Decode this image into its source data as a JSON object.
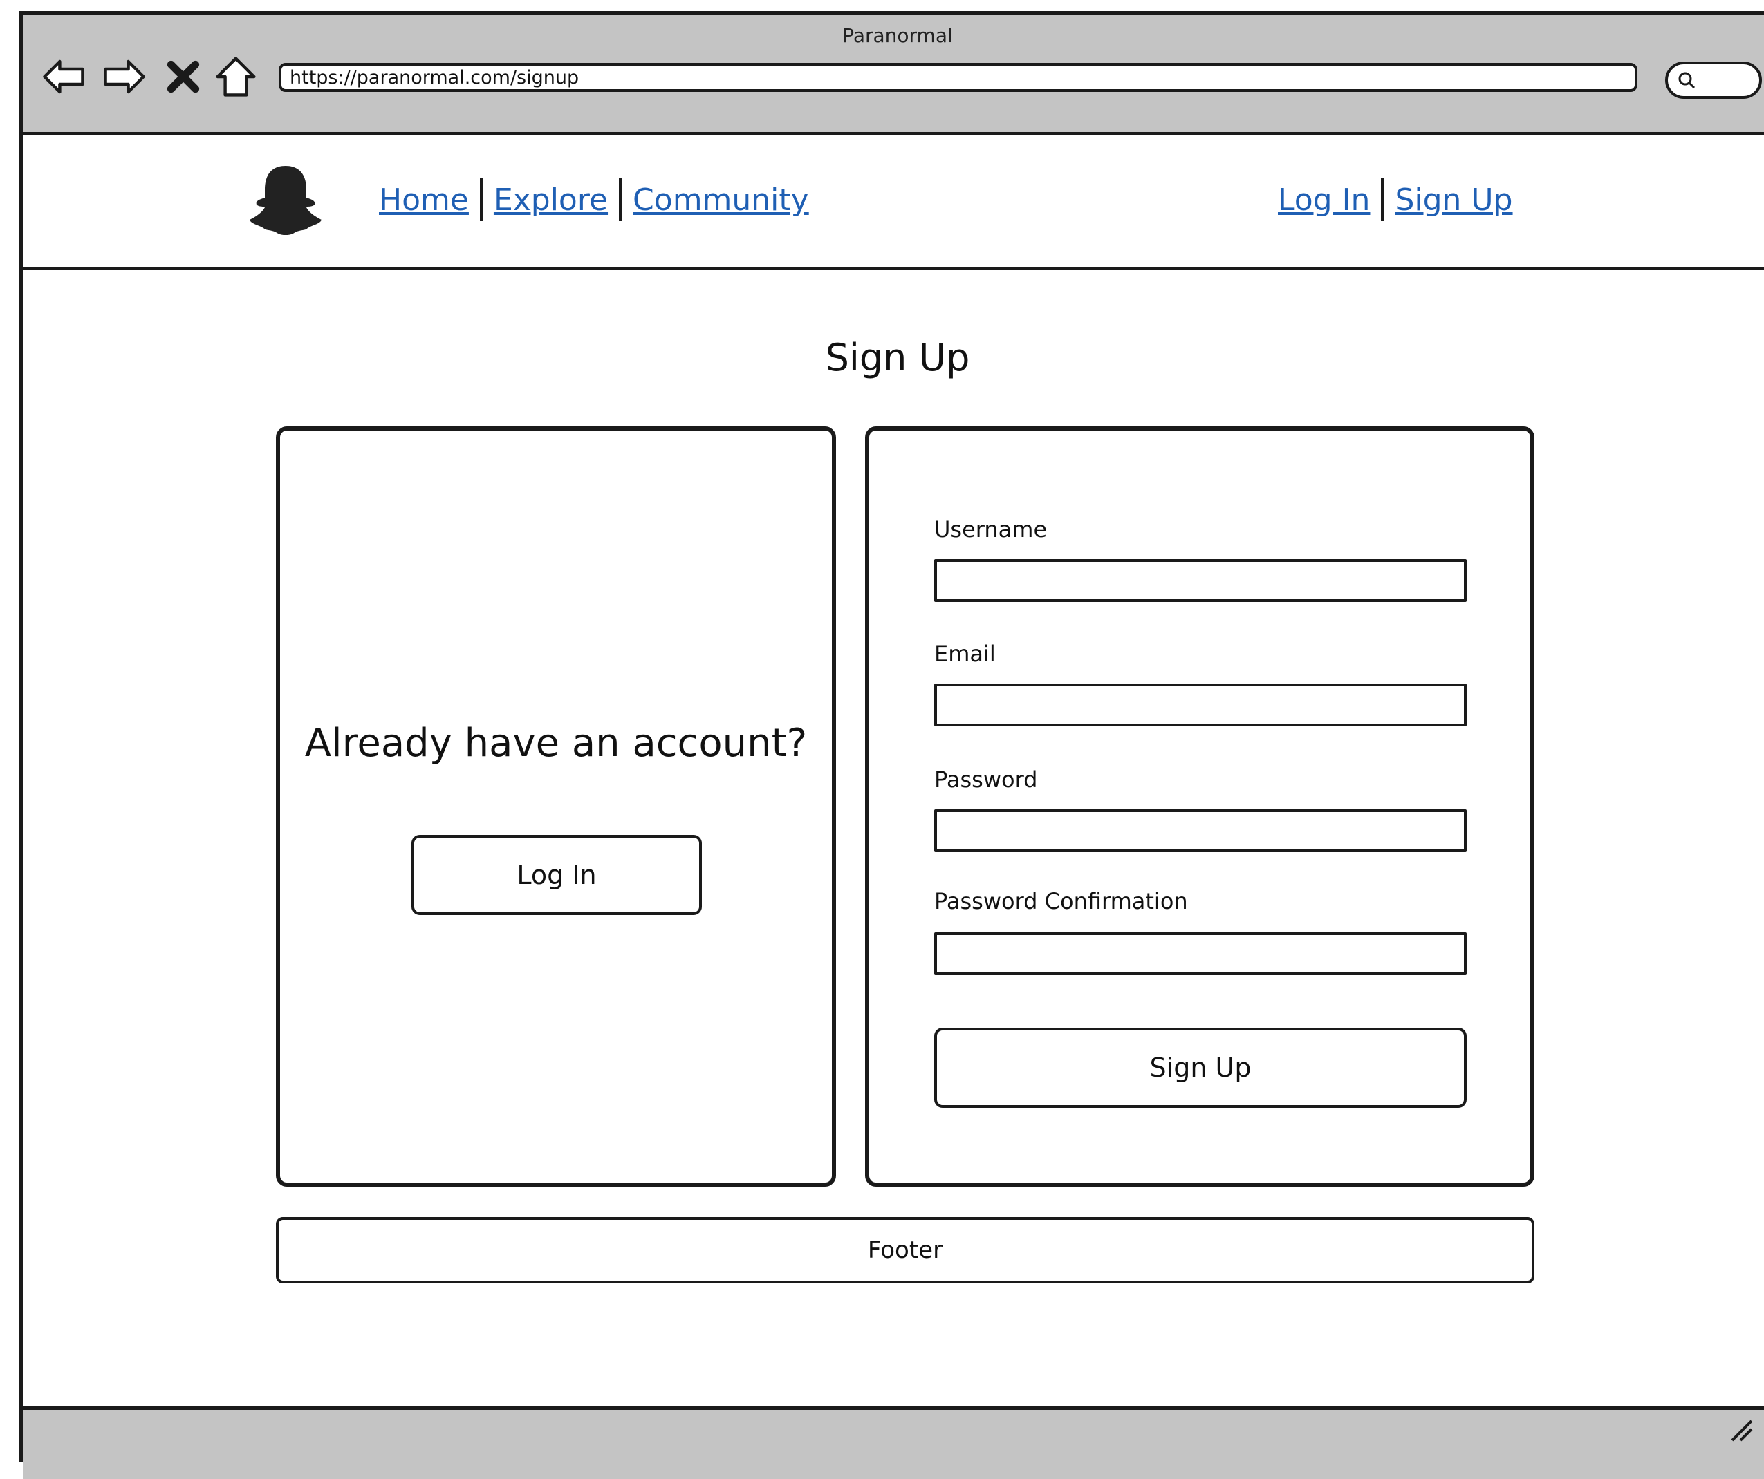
{
  "window": {
    "title": "Paranormal"
  },
  "browser": {
    "url": "https://paranormal.com/signup",
    "icons": [
      "back-arrow-icon",
      "forward-arrow-icon",
      "close-icon",
      "home-icon",
      "search-icon"
    ]
  },
  "header": {
    "logo_icon": "ghost-icon",
    "nav": [
      {
        "label": "Home"
      },
      {
        "label": "Explore"
      },
      {
        "label": "Community"
      }
    ],
    "auth": [
      {
        "label": "Log In"
      },
      {
        "label": "Sign Up"
      }
    ],
    "link_color": "#1f5fb4"
  },
  "main": {
    "title": "Sign Up",
    "left_panel": {
      "prompt": "Already have an account?",
      "login_button": "Log In"
    },
    "form": {
      "fields": [
        {
          "label": "Username",
          "value": ""
        },
        {
          "label": "Email",
          "value": ""
        },
        {
          "label": "Password",
          "value": ""
        },
        {
          "label": "Password Confirmation",
          "value": ""
        }
      ],
      "submit_label": "Sign Up"
    }
  },
  "footer": {
    "label": "Footer"
  },
  "colors": {
    "chrome": "#c4c4c4",
    "border": "#1a1a1a"
  }
}
